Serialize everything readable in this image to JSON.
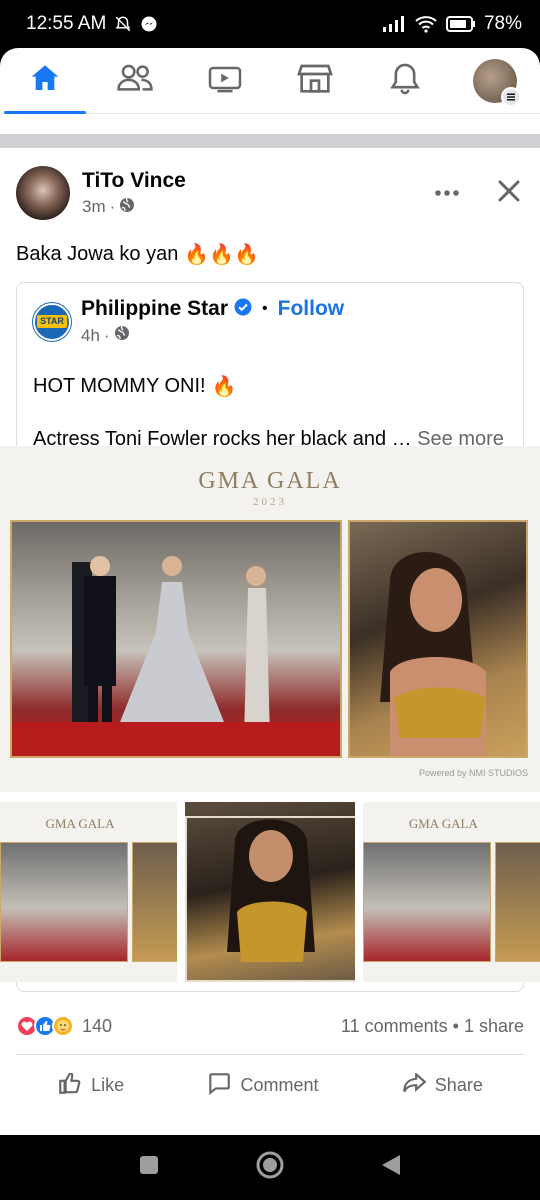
{
  "status_bar": {
    "time": "12:55 AM",
    "battery": "78%"
  },
  "nav": {
    "tabs": [
      {
        "name": "home",
        "icon": "home-icon",
        "active": true
      },
      {
        "name": "friends",
        "icon": "friends-icon",
        "active": false
      },
      {
        "name": "watch",
        "icon": "video-icon",
        "active": false
      },
      {
        "name": "marketplace",
        "icon": "marketplace-icon",
        "active": false
      },
      {
        "name": "notifications",
        "icon": "bell-icon",
        "active": false
      },
      {
        "name": "menu",
        "icon": "profile-avatar",
        "active": false
      }
    ]
  },
  "post": {
    "author": "TiTo Vince",
    "time": "3m",
    "privacy_icon": "globe-icon",
    "text": "Baka Jowa ko yan",
    "emoji": "🔥🔥🔥"
  },
  "shared_post": {
    "page_name": "Philippine Star",
    "logo_text": "STAR",
    "verified": true,
    "follow_label": "Follow",
    "time": "4h",
    "headline": "HOT MOMMY ONI!",
    "headline_emoji": "🔥",
    "body": "Actress Toni Fowler rocks her black and … ",
    "see_more": "See more"
  },
  "media": {
    "title": "GMA GALA",
    "year": "2023",
    "powered_by": "Powered by NMI STUDIOS"
  },
  "engagement": {
    "reaction_count": "140",
    "comments": "11 comments",
    "shares": "1 share",
    "separator": "•"
  },
  "actions": {
    "like": "Like",
    "comment": "Comment",
    "share": "Share"
  },
  "colors": {
    "accent": "#1877f2",
    "follow": "#1b74e4",
    "secondary_text": "#65676b"
  }
}
